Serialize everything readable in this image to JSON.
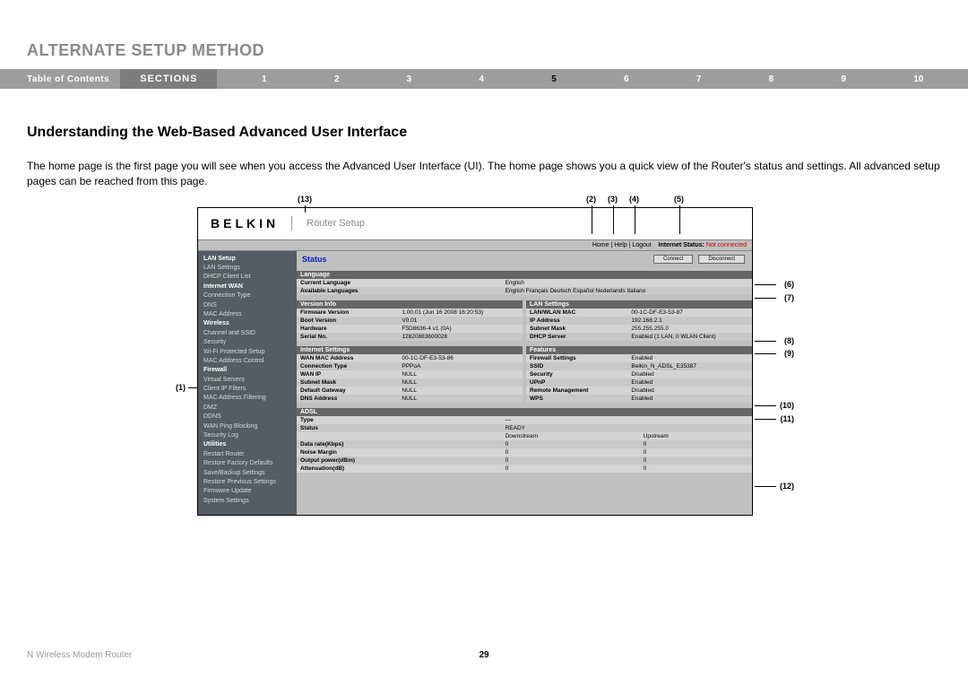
{
  "page_title": "ALTERNATE SETUP METHOD",
  "nav": {
    "toc": "Table of Contents",
    "sections_label": "SECTIONS",
    "numbers": [
      "1",
      "2",
      "3",
      "4",
      "5",
      "6",
      "7",
      "8",
      "9",
      "10"
    ],
    "active": "5"
  },
  "subheading": "Understanding the Web-Based Advanced User Interface",
  "intro": "The home page is the first page you will see when you access the Advanced User Interface (UI). The home page shows you a quick view of the Router's status and settings. All advanced setup pages can be reached from this page.",
  "callouts_top": {
    "c13": "(13)",
    "c2": "(2)",
    "c3": "(3)",
    "c4": "(4)",
    "c5": "(5)"
  },
  "callouts_side": {
    "c1": "(1)",
    "c6": "(6)",
    "c7": "(7)",
    "c8": "(8)",
    "c9": "(9)",
    "c10": "(10)",
    "c11": "(11)",
    "c12": "(12)"
  },
  "screenshot": {
    "logo": "BELKIN",
    "router_setup": "Router Setup",
    "topbar": {
      "links": "Home | Help | Logout",
      "status_label": "Internet Status:",
      "status_value": "Not connected"
    },
    "status": "Status",
    "buttons": {
      "connect": "Connect",
      "disconnect": "Disconnect"
    },
    "sidebar": [
      {
        "t": "LAN Setup",
        "b": true
      },
      {
        "t": "LAN Settings"
      },
      {
        "t": "DHCP Client List"
      },
      {
        "t": "Internet WAN",
        "b": true
      },
      {
        "t": "Connection Type"
      },
      {
        "t": "DNS"
      },
      {
        "t": "MAC Address"
      },
      {
        "t": "Wireless",
        "b": true
      },
      {
        "t": "Channel and SSID"
      },
      {
        "t": "Security"
      },
      {
        "t": "Wi-Fi Protected Setup"
      },
      {
        "t": "MAC Address Control"
      },
      {
        "t": "Firewall",
        "b": true
      },
      {
        "t": "Virtual Servers"
      },
      {
        "t": "Client IP Filters"
      },
      {
        "t": "MAC Address Filtering"
      },
      {
        "t": "DMZ"
      },
      {
        "t": "DDNS"
      },
      {
        "t": "WAN Ping Blocking"
      },
      {
        "t": "Security Log"
      },
      {
        "t": "Utilities",
        "b": true
      },
      {
        "t": "Restart Router"
      },
      {
        "t": "Restore Factory Defaults"
      },
      {
        "t": "Save/Backup Settings"
      },
      {
        "t": "Restore Previous Settings"
      },
      {
        "t": "Firmware Update"
      },
      {
        "t": "System Settings"
      }
    ],
    "language": {
      "title": "Language",
      "rows": [
        [
          "Current Language",
          "English"
        ],
        [
          "Available Languages",
          "English  Français  Deutsch  Español  Nederlands  Italiano"
        ]
      ]
    },
    "version": {
      "title": "Version Info",
      "rows": [
        [
          "Firmware Version",
          "1.00.01 (Jun 16 2008 16:20:53)"
        ],
        [
          "Boot Version",
          "V0.01"
        ],
        [
          "Hardware",
          "F5D8636-4 v1 (0A)"
        ],
        [
          "Serial No.",
          "12820883600028"
        ]
      ]
    },
    "lan": {
      "title": "LAN Settings",
      "rows": [
        [
          "LAN/WLAN MAC",
          "00-1C-DF-E3-53-87"
        ],
        [
          "IP Address",
          "192.168.2.1"
        ],
        [
          "Subnet Mask",
          "255.255.255.0"
        ],
        [
          "DHCP Server",
          "Enabled (1 LAN, 0 WLAN Client)"
        ]
      ]
    },
    "internet": {
      "title": "Internet Settings",
      "rows": [
        [
          "WAN MAC Address",
          "00-1C-DF-E3-53-86"
        ],
        [
          "Connection Type",
          "PPPoA"
        ],
        [
          "WAN IP",
          "NULL"
        ],
        [
          "Subnet Mask",
          "NULL"
        ],
        [
          "Default Gateway",
          "NULL"
        ],
        [
          "DNS Address",
          "NULL"
        ]
      ]
    },
    "features": {
      "title": "Features",
      "rows": [
        [
          "Firewall Settings",
          "Enabled"
        ],
        [
          "SSID",
          "Belkin_N_ADSL_E35387"
        ],
        [
          "Security",
          "Disabled"
        ],
        [
          "UPnP",
          "Enabled"
        ],
        [
          "Remote Management",
          "Disabled"
        ],
        [
          "WPS",
          "Enabled"
        ]
      ]
    },
    "adsl": {
      "title": "ADSL",
      "head": {
        "down": "Downstream",
        "up": "Upstream"
      },
      "rows": [
        [
          "Type",
          "—",
          ""
        ],
        [
          "Status",
          "READY",
          ""
        ],
        [
          "Data rate(Kbps)",
          "0",
          "0"
        ],
        [
          "Noise Margin",
          "0",
          "0"
        ],
        [
          "Output power(dBm)",
          "0",
          "0"
        ],
        [
          "Attenuation(dB)",
          "0",
          "0"
        ]
      ]
    }
  },
  "footer": {
    "product": "N Wireless Modem Router",
    "page": "29"
  }
}
